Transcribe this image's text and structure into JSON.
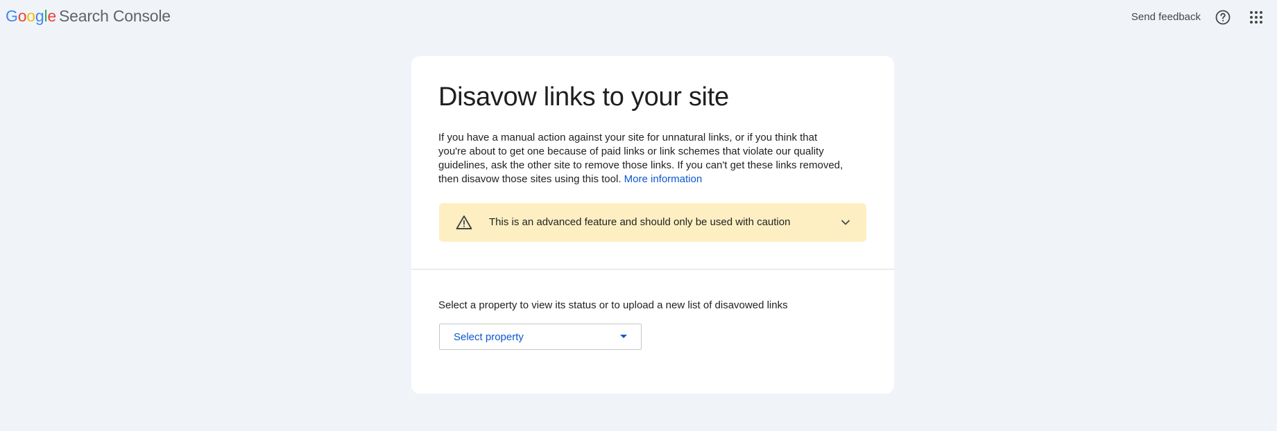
{
  "header": {
    "logo_letters": [
      "G",
      "o",
      "o",
      "g",
      "l",
      "e"
    ],
    "product_name": "Search Console",
    "send_feedback": "Send feedback",
    "help_icon": "help-circle-icon",
    "apps_icon": "apps-grid-icon"
  },
  "card": {
    "title": "Disavow links to your site",
    "description": "If you have a manual action against your site for unnatural links, or if you think that you're about to get one because of paid links or link schemes that violate our quality guidelines, ask the other site to remove those links. If you can't get these links removed, then disavow those sites using this tool.",
    "more_info_link": "More information",
    "warning": {
      "icon": "warning-triangle-icon",
      "text": "This is an advanced feature and should only be used with caution",
      "expand_icon": "chevron-down-icon"
    },
    "select_label": "Select a property to view its status or to upload a new list of disavowed links",
    "select_placeholder": "Select property"
  },
  "colors": {
    "page_background": "#f0f4f9",
    "card_background": "#ffffff",
    "link": "#0b57d0",
    "warning_background": "#feefc3"
  }
}
